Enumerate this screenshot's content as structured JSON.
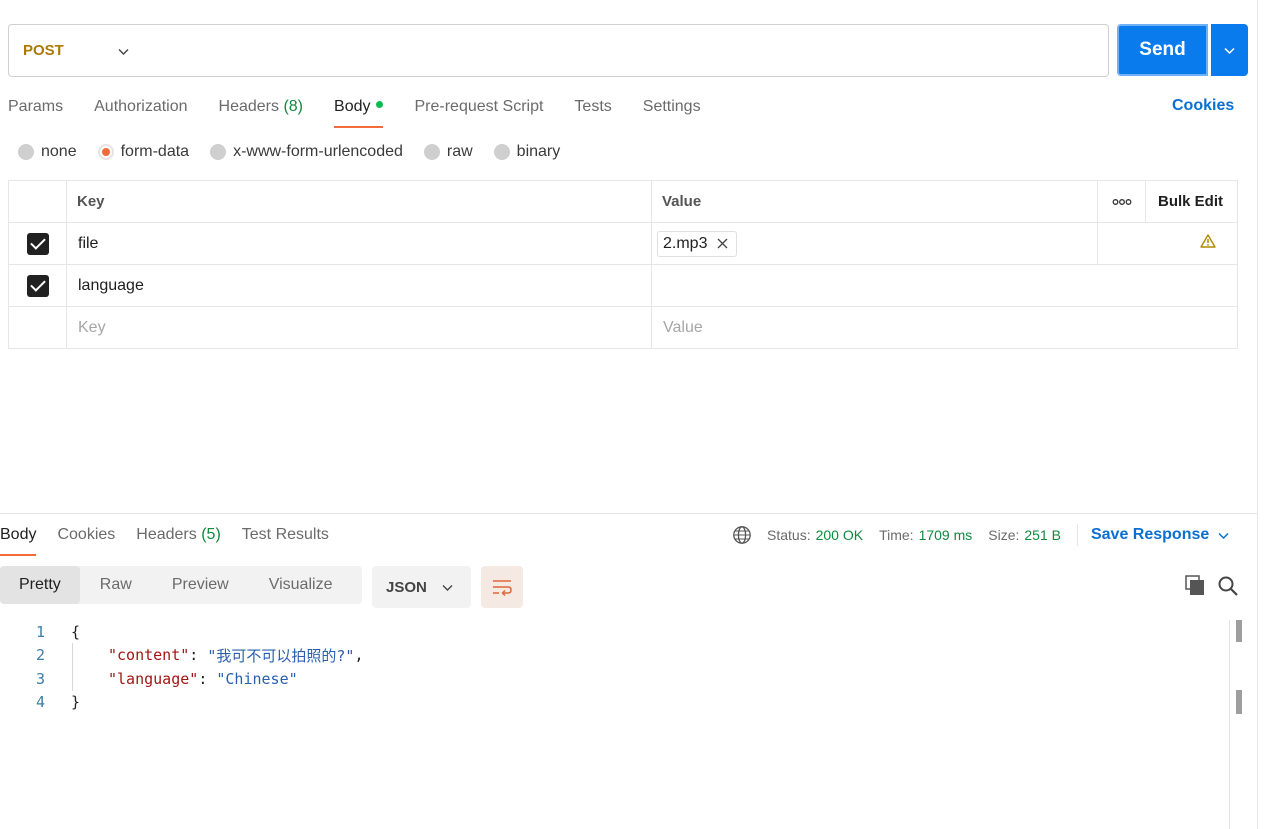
{
  "request": {
    "method": "POST",
    "url": "",
    "send_label": "Send"
  },
  "request_tabs": [
    {
      "label": "Params"
    },
    {
      "label": "Authorization"
    },
    {
      "label": "Headers",
      "count": "(8)"
    },
    {
      "label": "Body",
      "active": true
    },
    {
      "label": "Pre-request Script"
    },
    {
      "label": "Tests"
    },
    {
      "label": "Settings"
    }
  ],
  "cookies_label": "Cookies",
  "body_types": [
    {
      "label": "none"
    },
    {
      "label": "form-data",
      "selected": true
    },
    {
      "label": "x-www-form-urlencoded"
    },
    {
      "label": "raw"
    },
    {
      "label": "binary"
    }
  ],
  "params_table": {
    "headers": {
      "key": "Key",
      "value": "Value",
      "bulk_edit": "Bulk Edit"
    },
    "rows": [
      {
        "checked": true,
        "key": "file",
        "value": "2.mp3",
        "value_type": "file",
        "warning": true
      },
      {
        "checked": true,
        "key": "language",
        "value": ""
      }
    ],
    "placeholder": {
      "key": "Key",
      "value": "Value"
    }
  },
  "response": {
    "tabs": [
      {
        "label": "Body",
        "active": true
      },
      {
        "label": "Cookies"
      },
      {
        "label": "Headers",
        "count": "(5)"
      },
      {
        "label": "Test Results"
      }
    ],
    "status_label": "Status:",
    "status_value": "200 OK",
    "time_label": "Time:",
    "time_value": "1709 ms",
    "size_label": "Size:",
    "size_value": "251 B",
    "save_label": "Save Response",
    "formats": [
      "Pretty",
      "Raw",
      "Preview",
      "Visualize"
    ],
    "active_format": "Pretty",
    "language": "JSON",
    "code": {
      "line_numbers": [
        "1",
        "2",
        "3",
        "4"
      ],
      "open_brace": "{",
      "close_brace": "}",
      "key1": "\"content\"",
      "val1": "\"我可不可以拍照的?\"",
      "key2": "\"language\"",
      "val2": "\"Chinese\"",
      "colon": ": ",
      "comma": ","
    }
  },
  "colors": {
    "accent": "#f26b3a",
    "send": "#097bed",
    "method": "#ad7a03",
    "success": "#0f8a3d",
    "link": "#0b6fd1"
  }
}
